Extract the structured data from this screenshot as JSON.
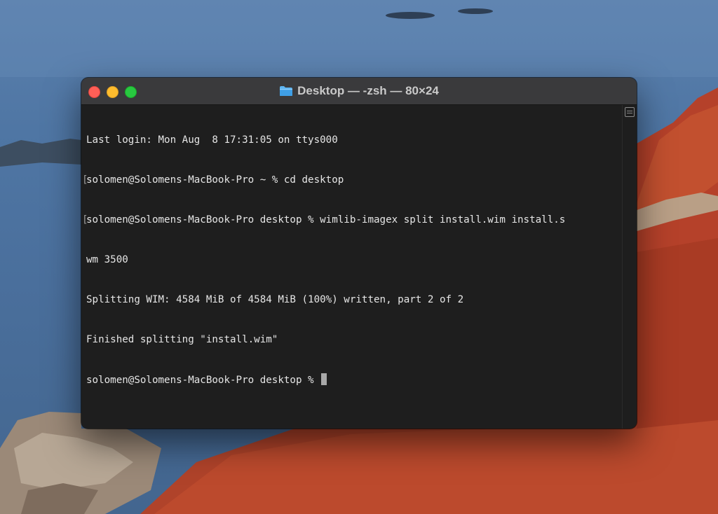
{
  "window": {
    "title": "Desktop — -zsh — 80×24",
    "folder_icon": "folder-icon",
    "colors": {
      "close": "#fe5f57",
      "minimize": "#febc2e",
      "maximize": "#28c840",
      "background": "#1e1e1e",
      "text": "#e6e6e6"
    }
  },
  "terminal": {
    "lines": [
      "Last login: Mon Aug  8 17:31:05 on ttys000",
      "solomen@Solomens-MacBook-Pro ~ % cd desktop",
      "solomen@Solomens-MacBook-Pro desktop % wimlib-imagex split install.wim install.s",
      "wm 3500",
      "Splitting WIM: 4584 MiB of 4584 MiB (100%) written, part 2 of 2",
      "Finished splitting \"install.wim\"",
      "solomen@Solomens-MacBook-Pro desktop % "
    ]
  }
}
